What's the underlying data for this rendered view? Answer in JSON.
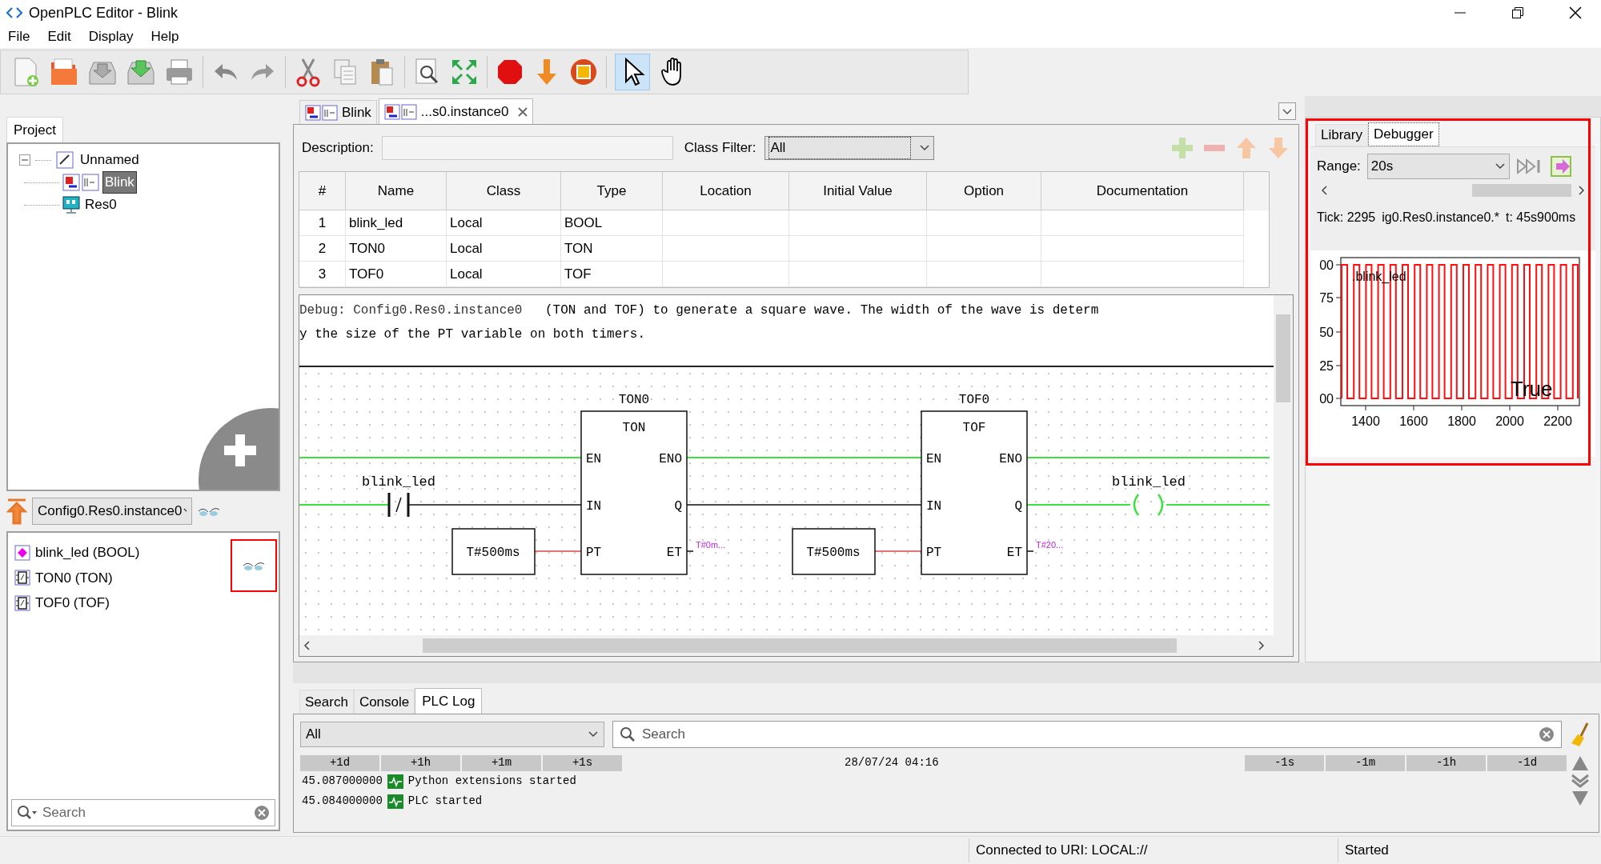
{
  "window": {
    "title": "OpenPLC Editor - Blink"
  },
  "menu": [
    "File",
    "Edit",
    "Display",
    "Help"
  ],
  "mode_tools": [
    {
      "kind": "pointer",
      "selected": true
    },
    {
      "kind": "hand",
      "selected": false
    }
  ],
  "project": {
    "tab": "Project",
    "tree": [
      {
        "label": "Unnamed",
        "expanded": true,
        "selected": false,
        "children": [
          {
            "label": "Blink",
            "selected": true
          },
          {
            "label": "Res0",
            "selected": false
          }
        ]
      }
    ],
    "instance": "Config0.Res0.instance0",
    "variables": [
      {
        "label": "blink_led (BOOL)",
        "kind": "variable"
      },
      {
        "label": "TON0 (TON)",
        "kind": "block"
      },
      {
        "label": "TOF0 (TOF)",
        "kind": "block"
      }
    ],
    "search_placeholder": "Search"
  },
  "editor": {
    "tabs": [
      {
        "label": "Blink",
        "selected": false,
        "closable": false
      },
      {
        "label": "...s0.instance0",
        "selected": true,
        "closable": true
      }
    ],
    "description_label": "Description:",
    "class_filter_label": "Class Filter:",
    "class_filter": "All",
    "columns": [
      "#",
      "Name",
      "Class",
      "Type",
      "Location",
      "Initial Value",
      "Option",
      "Documentation"
    ],
    "rows": [
      {
        "number": "1",
        "name": "blink_led",
        "class": "Local",
        "type": "BOOL"
      },
      {
        "number": "2",
        "name": "TON0",
        "class": "Local",
        "type": "TON"
      },
      {
        "number": "3",
        "name": "TOF0",
        "class": "Local",
        "type": "TOF"
      }
    ],
    "debug_label": "Debug: Config0.Res0.instance0",
    "comment": [
      "(TON and TOF) to generate a square wave. The width of the wave is determ",
      "y the size of the PT variable on both timers."
    ],
    "diagram": {
      "contact": "blink_led",
      "coil": "blink_led",
      "blocks": [
        {
          "instance": "TON0",
          "type": "TON",
          "inputs": [
            "EN",
            "IN",
            "PT"
          ],
          "outputs": [
            "ENO",
            "Q",
            "ET"
          ],
          "pt": "T#500ms",
          "et": "T#0m..."
        },
        {
          "instance": "TOF0",
          "type": "TOF",
          "inputs": [
            "EN",
            "IN",
            "PT"
          ],
          "outputs": [
            "ENO",
            "Q",
            "ET"
          ],
          "pt": "T#500ms",
          "et": "T#20..."
        }
      ]
    }
  },
  "debugger": {
    "tabs": [
      {
        "label": "Library",
        "selected": false
      },
      {
        "label": "Debugger",
        "selected": true
      }
    ],
    "range_label": "Range:",
    "range": "20s",
    "tick": "Tick: 2295",
    "variable": "ig0.Res0.instance0.*",
    "time": "t: 45s900ms",
    "plot": {
      "legend": ".blink_led",
      "value": "True",
      "y_ticks": [
        "00",
        "75",
        "50",
        "25",
        "00"
      ],
      "x_ticks": [
        "1400",
        "1600",
        "1800",
        "2000",
        "2200"
      ]
    }
  },
  "log": {
    "tabs": [
      {
        "label": "Search",
        "selected": false
      },
      {
        "label": "Console",
        "selected": false
      },
      {
        "label": "PLC Log",
        "selected": true
      }
    ],
    "filter": "All",
    "search_placeholder": "Search",
    "forward_buttons": [
      "+1d",
      "+1h",
      "+1m",
      "+1s"
    ],
    "date": "28/07/24 04:16",
    "back_buttons": [
      "-1s",
      "-1m",
      "-1h",
      "-1d"
    ],
    "entries": [
      {
        "time": "45.087000000",
        "text": "Python extensions started"
      },
      {
        "time": "45.084000000",
        "text": "PLC started"
      }
    ]
  },
  "status_bar": [
    "Connected to URI: LOCAL://",
    "Started"
  ]
}
